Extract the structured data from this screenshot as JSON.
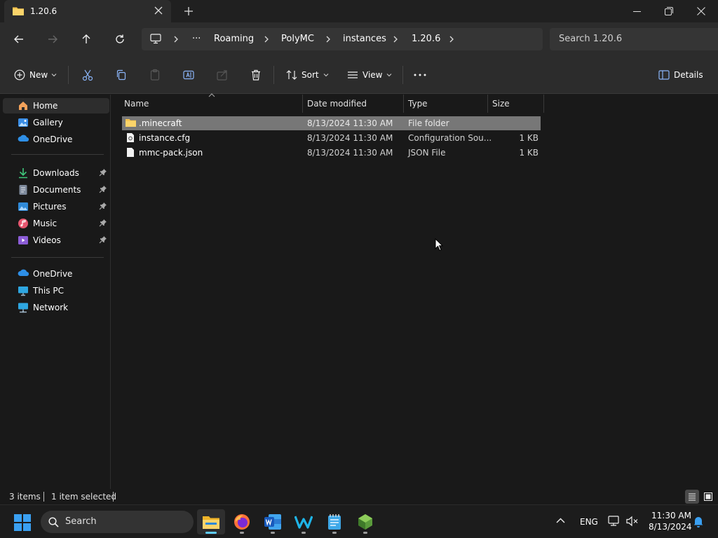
{
  "window": {
    "tab_title": "1.20.6"
  },
  "address_bar": {
    "breadcrumbs": [
      "Roaming",
      "PolyMC",
      "instances",
      "1.20.6"
    ],
    "overflow": "···",
    "search_placeholder": "Search 1.20.6"
  },
  "command_bar": {
    "new_label": "New",
    "sort_label": "Sort",
    "view_label": "View",
    "details_label": "Details"
  },
  "sidebar": {
    "items": [
      {
        "label": "Home",
        "icon": "home-icon"
      },
      {
        "label": "Gallery",
        "icon": "gallery-icon"
      },
      {
        "label": "OneDrive",
        "icon": "onedrive-icon"
      },
      {
        "label": "Downloads",
        "icon": "downloads-icon"
      },
      {
        "label": "Documents",
        "icon": "documents-icon"
      },
      {
        "label": "Pictures",
        "icon": "pictures-icon"
      },
      {
        "label": "Music",
        "icon": "music-icon"
      },
      {
        "label": "Videos",
        "icon": "videos-icon"
      },
      {
        "label": "OneDrive",
        "icon": "onedrive-icon"
      },
      {
        "label": "This PC",
        "icon": "this-pc-icon"
      },
      {
        "label": "Network",
        "icon": "network-icon"
      }
    ]
  },
  "columns": {
    "name": "Name",
    "date": "Date modified",
    "type": "Type",
    "size": "Size"
  },
  "files": [
    {
      "name": ".minecraft",
      "date": "8/13/2024 11:30 AM",
      "type": "File folder",
      "size": ""
    },
    {
      "name": "instance.cfg",
      "date": "8/13/2024 11:30 AM",
      "type": "Configuration Sou...",
      "size": "1 KB"
    },
    {
      "name": "mmc-pack.json",
      "date": "8/13/2024 11:30 AM",
      "type": "JSON File",
      "size": "1 KB"
    }
  ],
  "status": {
    "item_count": "3 items",
    "selected": "1 item selected"
  },
  "taskbar": {
    "search_label": "Search",
    "lang": "ENG",
    "time": "11:30 AM",
    "date": "8/13/2024"
  },
  "colors": {
    "accent": "#60cdff",
    "folder": "#f8c44f",
    "selection": "#777777"
  }
}
